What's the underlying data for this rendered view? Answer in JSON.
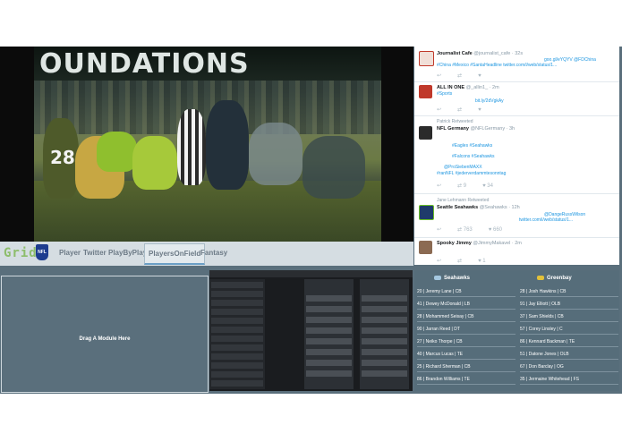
{
  "video": {
    "banner_text": "OUNDATIONS",
    "jersey_number": "28"
  },
  "nav": {
    "logo": "Grid",
    "nfl_icon": "NFL",
    "items": [
      {
        "label": "Player"
      },
      {
        "label": "Twitter"
      },
      {
        "label": "PlayByPlay"
      },
      {
        "label": "PlayersOnField",
        "active": true
      },
      {
        "label": "Fantasy"
      }
    ]
  },
  "twitter": {
    "tweets": [
      {
        "name": "Journalist Cafe",
        "handle": "@journalist_cafe · 32s",
        "lines": [
          "goo.gl/eYQYV @FDChina",
          "#China #Mexico #SantaHeadline  twitter.com/i/web/status/1..."
        ],
        "actions": [
          "↩",
          "⇄",
          "♥"
        ]
      },
      {
        "name": "ALL IN ONE",
        "handle": "@_allin1_ · 2m",
        "lines": [
          "#Sports",
          "bit.ly/2dVgkAy"
        ],
        "actions": [
          "↩",
          "⇄",
          "♥"
        ]
      },
      {
        "retweet_by": "Patrick Retweeted",
        "name": "NFL Germany",
        "handle": "@NFLGermany · 3h",
        "lines": [
          "#Eagles  #Seahawks",
          "#Falcons  #Seahawks",
          "@ProSiebenMAXX",
          "#ranNFL #jederverdammtesonntag"
        ],
        "actions": [
          "↩",
          "⇄ 9",
          "♥ 34"
        ]
      },
      {
        "retweet_by": "Jane Lehmann Retweeted",
        "name": "Seattle Seahawks",
        "handle": "@Seahawks · 12h",
        "lines": [
          "@DangeRussWilson",
          "twitter.com/i/web/status/1..."
        ],
        "actions": [
          "↩",
          "⇄ 763",
          "♥ 660"
        ]
      },
      {
        "name": "Spooky Jimmy",
        "handle": "@JimmyMakavel · 2m",
        "lines": [],
        "actions": [
          "↩",
          "⇄",
          "♥ 1"
        ]
      }
    ]
  },
  "drag_area": {
    "label": "Drag A Module Here"
  },
  "roster": {
    "teams": [
      {
        "name": "Seahawks",
        "players": [
          "20 | Jeremy Lane | CB",
          "41 | Dewey McDonald | LB",
          "28 | Mohammed Seisay | CB",
          "90 | Jarran Reed | DT",
          "27 | Neiko Thorpe | CB",
          "40 | Marcus Lucas | TE",
          "25 | Richard Sherman | CB",
          "86 | Brandon Williams | TE"
        ]
      },
      {
        "name": "Greenbay",
        "players": [
          "28 | Josh Hawkins | CB",
          "91 | Jay Elliott | OLB",
          "37 | Sam Shields | CB",
          "57 | Corey Linsley | C",
          "86 | Kennard Backman | TE",
          "51 | Datone Jones | OLB",
          "67 | Don Barclay | OG",
          "35 | Jermaine Whitehead | FS"
        ]
      }
    ]
  },
  "colors": {
    "app_background": "#5a6f7c",
    "nav_background": "#d5dde2",
    "nav_text": "#6c7a86",
    "logo_green": "#8dbd6b",
    "twitter_link": "#1b95e0"
  }
}
